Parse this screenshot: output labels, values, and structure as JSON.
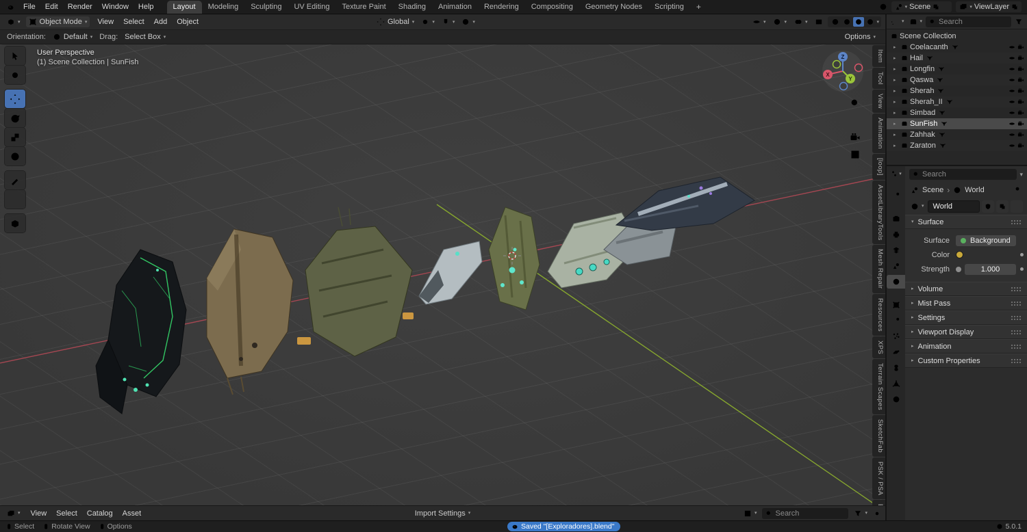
{
  "icons": {
    "chevron_down": "▾",
    "chevron_right": "▸",
    "breadcrumb_sep": "›",
    "plus": "+"
  },
  "topbar": {
    "menus": [
      "File",
      "Edit",
      "Render",
      "Window",
      "Help"
    ],
    "workspaces": [
      "Layout",
      "Modeling",
      "Sculpting",
      "UV Editing",
      "Texture Paint",
      "Shading",
      "Animation",
      "Rendering",
      "Compositing",
      "Geometry Nodes",
      "Scripting"
    ],
    "active_workspace": "Layout",
    "scene_name": "Scene",
    "view_layer_name": "ViewLayer"
  },
  "viewport_header": {
    "mode": "Object Mode",
    "menus": [
      "View",
      "Select",
      "Add",
      "Object"
    ],
    "orientation": "Global"
  },
  "tool_settings": {
    "orientation_label": "Orientation:",
    "orientation_value": "Default",
    "drag_label": "Drag:",
    "drag_value": "Select Box",
    "options_label": "Options"
  },
  "viewport": {
    "perspective_label": "User Perspective",
    "context_label": "(1) Scene Collection | SunFish",
    "gizmo": {
      "x": "X",
      "y": "Y",
      "z": "Z"
    },
    "sidebar_tabs": [
      "Item",
      "Tool",
      "View",
      "Animation",
      "[loop]",
      "AssetLibraryTools",
      "Mesh Repair",
      "Resources",
      "XPS",
      "Terrain Scapes",
      "SketchFab",
      "PSK / PSA",
      "BCE"
    ]
  },
  "outliner": {
    "search_placeholder": "Search",
    "root_label": "Scene Collection",
    "collections": [
      "Coelacanth",
      "Hail",
      "Longfin",
      "Qaswa",
      "Sherah",
      "Sherah_II",
      "Simbad",
      "SunFish",
      "Zahhak",
      "Zaraton"
    ],
    "active": "SunFish"
  },
  "properties": {
    "search_placeholder": "Search",
    "breadcrumb": {
      "scene": "Scene",
      "world": "World"
    },
    "world_name": "World",
    "surface_panel": {
      "title": "Surface",
      "surface_label": "Surface",
      "surface_value": "Background",
      "color_label": "Color",
      "strength_label": "Strength",
      "strength_value": "1.000"
    },
    "collapsed_panels": [
      "Volume",
      "Mist Pass",
      "Settings",
      "Viewport Display",
      "Animation",
      "Custom Properties"
    ]
  },
  "asset_browser": {
    "menus": [
      "View",
      "Select",
      "Catalog",
      "Asset"
    ],
    "import_settings_label": "Import Settings",
    "search_placeholder": "Search"
  },
  "statusbar": {
    "hints": [
      "Select",
      "Rotate View",
      "Options"
    ],
    "notification": "Saved \"[Exploradores].blend\"",
    "version": "5.0.1"
  }
}
